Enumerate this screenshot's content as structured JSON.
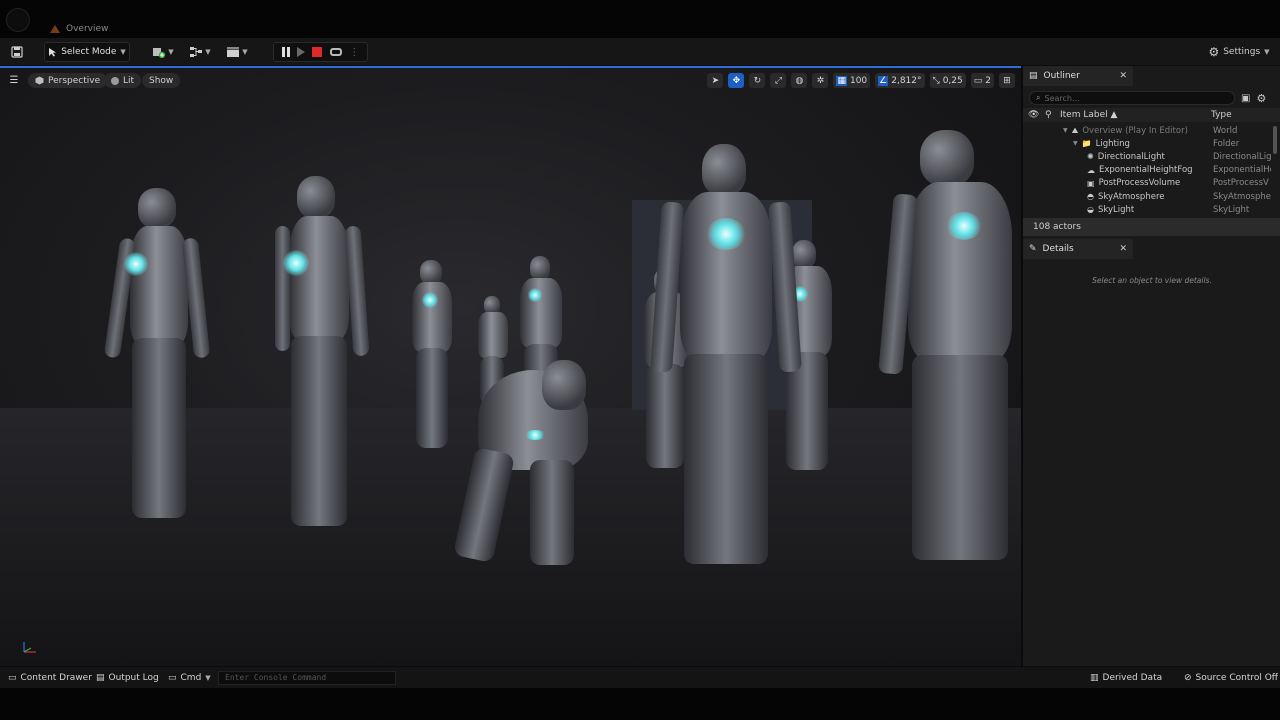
{
  "window": {
    "level_tab": "Overview"
  },
  "toolbar": {
    "select_mode": "Select Mode",
    "settings": "Settings"
  },
  "viewport": {
    "perspective": "Perspective",
    "lit": "Lit",
    "show": "Show",
    "grid_snap": "100",
    "rotation_snap": "2,812°",
    "scale_snap": "0,25",
    "camera_speed": "2"
  },
  "outliner": {
    "tab": "Outliner",
    "search_placeholder": "Search...",
    "col_label": "Item Label ▲",
    "col_type": "Type",
    "rows": [
      {
        "label": "Overview (Play In Editor)",
        "type": "World",
        "indent": 40,
        "icon": "world-icon",
        "dim": true
      },
      {
        "label": "Lighting",
        "type": "Folder",
        "indent": 50,
        "icon": "folder-icon",
        "dim": false
      },
      {
        "label": "DirectionalLight",
        "type": "DirectionalLight",
        "indent": 64,
        "icon": "sun-icon",
        "dim": false
      },
      {
        "label": "ExponentialHeightFog",
        "type": "ExponentialHe",
        "indent": 64,
        "icon": "fog-icon",
        "dim": false
      },
      {
        "label": "PostProcessVolume",
        "type": "PostProcessV",
        "indent": 64,
        "icon": "volume-icon",
        "dim": false
      },
      {
        "label": "SkyAtmosphere",
        "type": "SkyAtmosphere",
        "indent": 64,
        "icon": "sky-icon",
        "dim": false
      },
      {
        "label": "SkyLight",
        "type": "SkyLight",
        "indent": 64,
        "icon": "skylight-icon",
        "dim": false
      }
    ],
    "actor_count": "108 actors"
  },
  "details": {
    "tab": "Details",
    "empty_text": "Select an object to view details."
  },
  "bottombar": {
    "content_drawer": "Content Drawer",
    "output_log": "Output Log",
    "cmd": "Cmd",
    "console_placeholder": "Enter Console Command",
    "derived_data": "Derived Data",
    "source_control": "Source Control Off"
  },
  "colors": {
    "accent": "#2b6fd8",
    "stop": "#e02a2a",
    "glow": "#5fe0e6"
  }
}
